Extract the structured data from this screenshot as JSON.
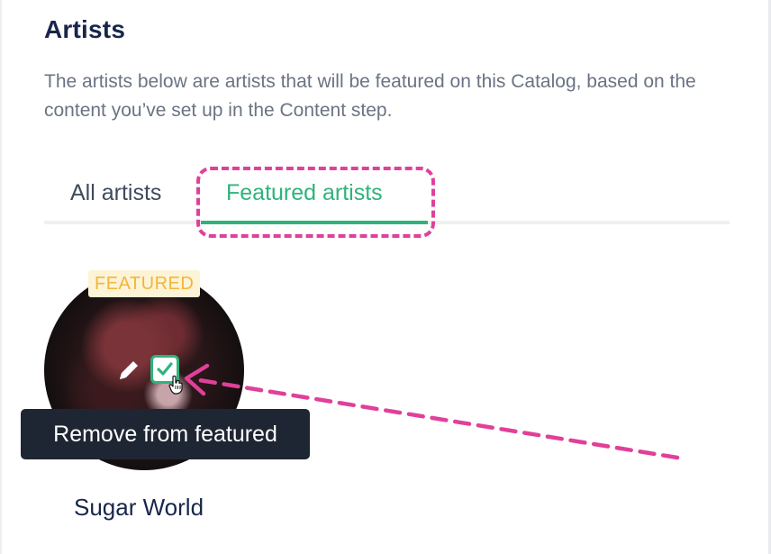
{
  "section": {
    "title": "Artists",
    "description": "The artists below are artists that will be featured on this Catalog, based on the content you’ve set up in the Content step."
  },
  "tabs": [
    {
      "label": "All artists",
      "active": false
    },
    {
      "label": "Featured artists",
      "active": true
    }
  ],
  "artists": [
    {
      "name": "Sugar World",
      "badge": "FEATURED",
      "featured": true
    }
  ],
  "tooltip": {
    "text": "Remove from featured"
  },
  "icons": {
    "edit": "pencil-icon",
    "check": "checkmark-icon",
    "cursor": "hand-pointer-icon"
  },
  "colors": {
    "accent_green": "#2fb37c",
    "annotation_pink": "#e0409a",
    "badge_text": "#f2b63b",
    "badge_bg": "#fdf3d6",
    "title_navy": "#18264a",
    "tooltip_bg": "#1f2633"
  }
}
